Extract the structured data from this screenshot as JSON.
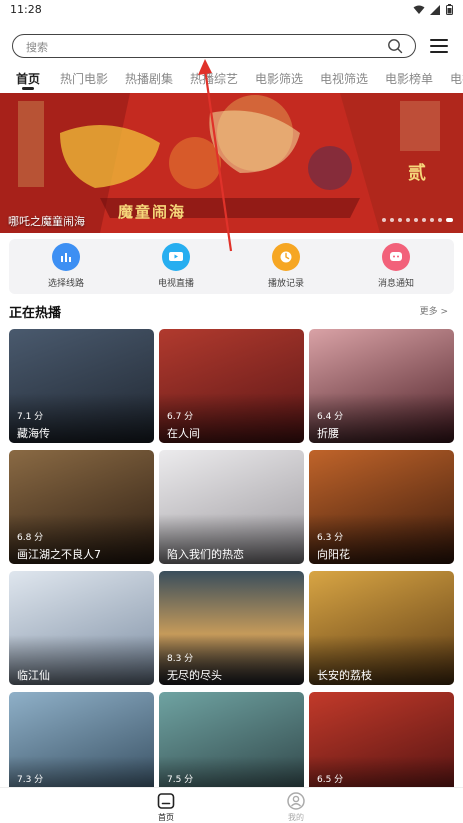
{
  "status_bar": {
    "time": "11:28",
    "icons": [
      "wifi-icon",
      "signal-icon",
      "battery-icon"
    ]
  },
  "search": {
    "placeholder": "搜索",
    "icon": "search-icon"
  },
  "menu": {
    "icon": "menu-icon"
  },
  "tabs": [
    {
      "label": "首页",
      "active": true
    },
    {
      "label": "热门电影",
      "active": false
    },
    {
      "label": "热播剧集",
      "active": false
    },
    {
      "label": "热播综艺",
      "active": false
    },
    {
      "label": "电影筛选",
      "active": false
    },
    {
      "label": "电视筛选",
      "active": false
    },
    {
      "label": "电影榜单",
      "active": false
    },
    {
      "label": "电视",
      "active": false
    }
  ],
  "banner": {
    "caption": "哪吒之魔童闹海",
    "poster_text": [
      "魔童闹海",
      "贰"
    ],
    "slide_count": 9,
    "active_slide": 9
  },
  "quick_actions": [
    {
      "label": "选择线路",
      "icon": "route-icon",
      "color": "#3d8ff3"
    },
    {
      "label": "电视直播",
      "icon": "tv-icon",
      "color": "#27aef0"
    },
    {
      "label": "播放记录",
      "icon": "clock-icon",
      "color": "#f6a623"
    },
    {
      "label": "消息通知",
      "icon": "message-icon",
      "color": "#f2617a"
    }
  ],
  "section": {
    "title": "正在热播",
    "more": "更多 >"
  },
  "cards": [
    {
      "title": "藏海传",
      "rating": "7.1 分",
      "bg": "#2e3a4a"
    },
    {
      "title": "在人间",
      "rating": "6.7 分",
      "bg": "#8a2b2b"
    },
    {
      "title": "折腰",
      "rating": "6.4 分",
      "bg": "#6d2f3a"
    },
    {
      "title": "画江湖之不良人7",
      "rating": "6.8 分",
      "bg": "#4a3424"
    },
    {
      "title": "陷入我们的热恋",
      "rating": "",
      "bg": "#c9c7c9"
    },
    {
      "title": "向阳花",
      "rating": "6.3 分",
      "bg": "#7a3a18"
    },
    {
      "title": "临江仙",
      "rating": "",
      "bg": "#a9b8c8"
    },
    {
      "title": "无尽的尽头",
      "rating": "8.3 分",
      "bg": "#30404a"
    },
    {
      "title": "长安的荔枝",
      "rating": "",
      "bg": "#b07e2e"
    },
    {
      "title": "",
      "rating": "7.3 分",
      "bg": "#5b7d9a"
    },
    {
      "title": "",
      "rating": "7.5 分",
      "bg": "#3e6a6e"
    },
    {
      "title": "",
      "rating": "6.5 分",
      "bg": "#8e2424"
    }
  ],
  "bottom_nav": [
    {
      "label": "首页",
      "icon": "home-icon",
      "active": true,
      "color": "#222222"
    },
    {
      "label": "我的",
      "icon": "profile-icon",
      "active": false,
      "color": "#aaaaaa"
    }
  ],
  "colors": {
    "accent": "#222222",
    "annotation": "#e0322a"
  }
}
